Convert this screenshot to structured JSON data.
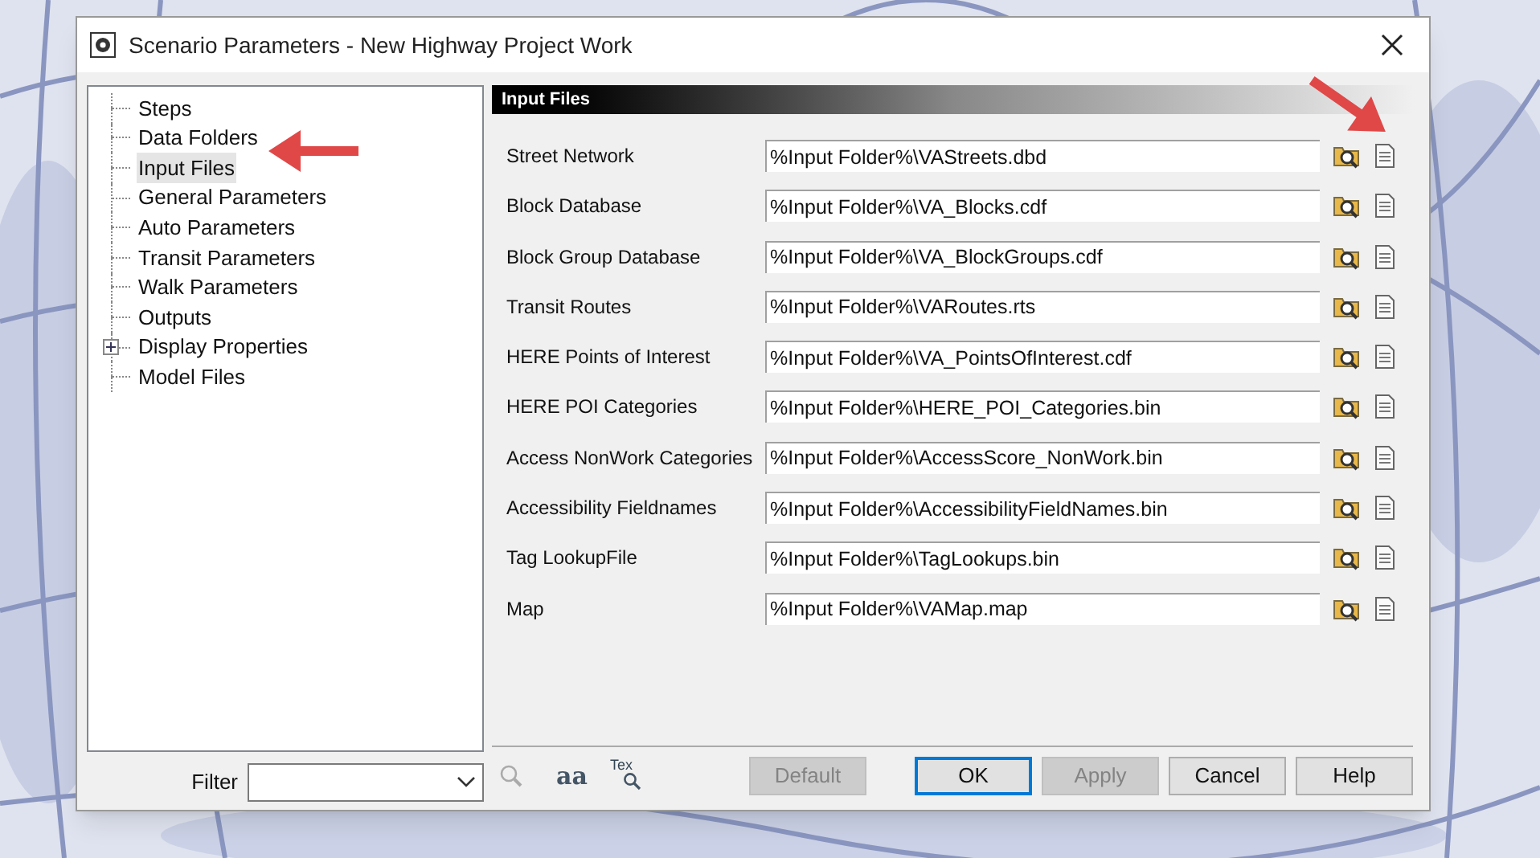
{
  "window": {
    "title": "Scenario Parameters - New Highway Project Work"
  },
  "tree": [
    {
      "label": "Steps",
      "selected": false
    },
    {
      "label": "Data Folders",
      "selected": false
    },
    {
      "label": "Input Files",
      "selected": true
    },
    {
      "label": "General Parameters",
      "selected": false
    },
    {
      "label": "Auto Parameters",
      "selected": false
    },
    {
      "label": "Transit Parameters",
      "selected": false
    },
    {
      "label": "Walk Parameters",
      "selected": false
    },
    {
      "label": "Outputs",
      "selected": false
    },
    {
      "label": "Display Properties",
      "selected": false,
      "expanded": false
    },
    {
      "label": "Model Files",
      "selected": false
    }
  ],
  "panel": {
    "title": "Input Files",
    "rows": [
      {
        "label": "Street Network",
        "value": "%Input Folder%\\VAStreets.dbd"
      },
      {
        "label": "Block Database",
        "value": "%Input Folder%\\VA_Blocks.cdf"
      },
      {
        "label": "Block Group Database",
        "value": "%Input Folder%\\VA_BlockGroups.cdf"
      },
      {
        "label": "Transit Routes",
        "value": "%Input Folder%\\VARoutes.rts"
      },
      {
        "label": "HERE Points of Interest",
        "value": "%Input Folder%\\VA_PointsOfInterest.cdf"
      },
      {
        "label": "HERE POI Categories",
        "value": "%Input Folder%\\HERE_POI_Categories.bin"
      },
      {
        "label": "Access NonWork Categories",
        "value": "%Input Folder%\\AccessScore_NonWork.bin"
      },
      {
        "label": "Accessibility Fieldnames",
        "value": "%Input Folder%\\AccessibilityFieldNames.bin"
      },
      {
        "label": "Tag LookupFile",
        "value": "%Input Folder%\\TagLookups.bin"
      },
      {
        "label": "Map",
        "value": "%Input Folder%\\VAMap.map"
      }
    ]
  },
  "filter": {
    "label": "Filter"
  },
  "toolbar": {
    "case_label": "aa",
    "text_search_label": "Tex"
  },
  "buttons": [
    {
      "label": "Default",
      "disabled": true,
      "default": false
    },
    {
      "label": "OK",
      "disabled": false,
      "default": true
    },
    {
      "label": "Apply",
      "disabled": true,
      "default": false
    },
    {
      "label": "Cancel",
      "disabled": false,
      "default": false
    },
    {
      "label": "Help",
      "disabled": false,
      "default": false
    }
  ]
}
